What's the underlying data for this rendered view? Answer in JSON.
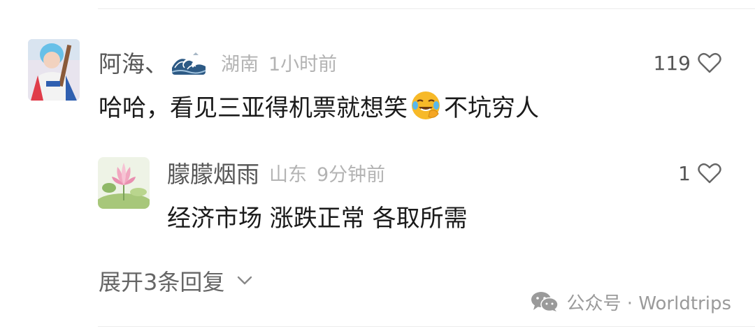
{
  "main_comment": {
    "username": "阿海、",
    "badge_icon": "great-wave-icon",
    "location": "湖南",
    "time": "1小时前",
    "text_before_emoji": "哈哈，看见三亚得机票就想笑",
    "emoji": "laughing-crying-emoji",
    "text_after_emoji": "不坑穷人",
    "like_count": "119"
  },
  "reply": {
    "username": "朦朦烟雨",
    "location": "山东",
    "time": "9分钟前",
    "text": "经济市场 涨跌正常 各取所需",
    "like_count": "1"
  },
  "expand_replies": {
    "label": "展开3条回复"
  },
  "watermark": {
    "icon": "wechat-icon",
    "text": "公众号 · Worldtrips"
  },
  "colors": {
    "username": "#555555",
    "meta": "#b3b3b3",
    "text": "#1a1a1a",
    "divider": "#ececec"
  }
}
